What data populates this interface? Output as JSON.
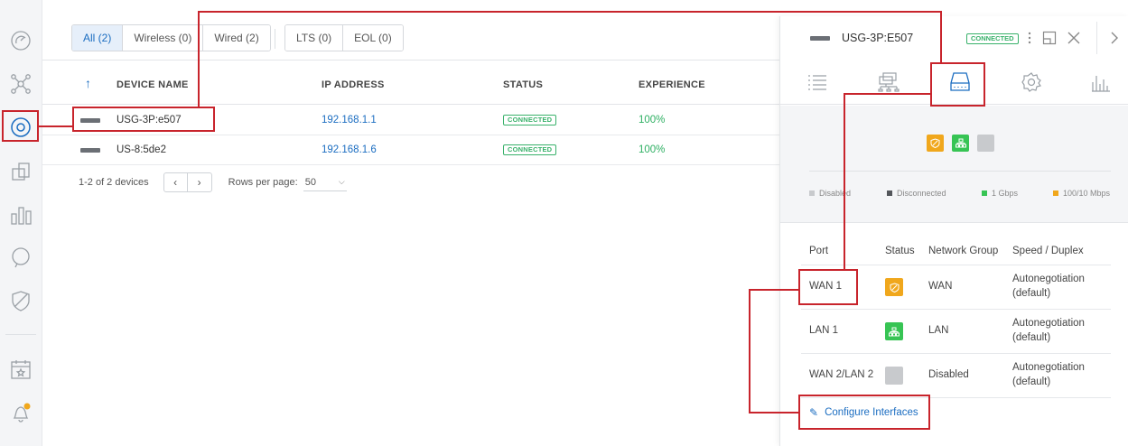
{
  "sidebar": {
    "items": [
      {
        "icon": "dashboard-icon"
      },
      {
        "icon": "topology-icon"
      },
      {
        "icon": "devices-icon",
        "active": true
      },
      {
        "icon": "clients-icon"
      },
      {
        "icon": "statistics-icon"
      },
      {
        "icon": "insights-icon"
      },
      {
        "icon": "threat-management-icon"
      },
      {
        "icon": "events-icon"
      },
      {
        "icon": "alerts-icon",
        "has_notification": true
      }
    ]
  },
  "filters": {
    "group1": [
      "All (2)",
      "Wireless (0)",
      "Wired (2)"
    ],
    "group2": [
      "LTS (0)",
      "EOL (0)"
    ],
    "active": "All (2)"
  },
  "table": {
    "columns": [
      "DEVICE NAME",
      "IP ADDRESS",
      "STATUS",
      "EXPERIENCE"
    ],
    "sort_icon": "arrow-up-icon",
    "rows": [
      {
        "name": "USG-3P:e507",
        "ip": "192.168.1.1",
        "status": "CONNECTED",
        "experience": "100%"
      },
      {
        "name": "US-8:5de2",
        "ip": "192.168.1.6",
        "status": "CONNECTED",
        "experience": "100%"
      }
    ]
  },
  "pagination": {
    "summary": "1-2 of 2 devices",
    "prev": "‹",
    "next": "›",
    "rows_per_page_label": "Rows per page:",
    "rows_per_page_value": "50"
  },
  "panel": {
    "title": "USG-3P:E507",
    "status_badge": "CONNECTED",
    "tabs": [
      "details-icon",
      "uplink-icon",
      "ports-icon",
      "settings-icon",
      "statistics-icon"
    ],
    "active_tab": "ports-icon",
    "legend": [
      {
        "label": "Disabled",
        "color": "#c8cacd"
      },
      {
        "label": "Disconnected",
        "color": "#53565b"
      },
      {
        "label": "1 Gbps",
        "color": "#37c454"
      },
      {
        "label": "100/10 Mbps",
        "color": "#f0a71c"
      }
    ],
    "port_table": {
      "headers": [
        "Port",
        "Status",
        "Network Group",
        "Speed / Duplex"
      ],
      "rows": [
        {
          "port": "WAN 1",
          "status_icon": "wan-shield-icon",
          "status_color": "#f0a71c",
          "group": "WAN",
          "speed_line1": "Autonegotiation",
          "speed_line2": "(default)"
        },
        {
          "port": "LAN 1",
          "status_icon": "lan-network-icon",
          "status_color": "#37c454",
          "group": "LAN",
          "speed_line1": "Autonegotiation",
          "speed_line2": "(default)"
        },
        {
          "port": "WAN 2/LAN 2",
          "status_icon": "disabled-port-icon",
          "status_color": "#c8cacd",
          "group": "Disabled",
          "speed_line1": "Autonegotiation",
          "speed_line2": "(default)"
        }
      ]
    },
    "configure_label": "Configure Interfaces"
  },
  "colors": {
    "accent": "#1b6dc1",
    "connected": "#38b16a",
    "annotation": "#c8242c"
  }
}
